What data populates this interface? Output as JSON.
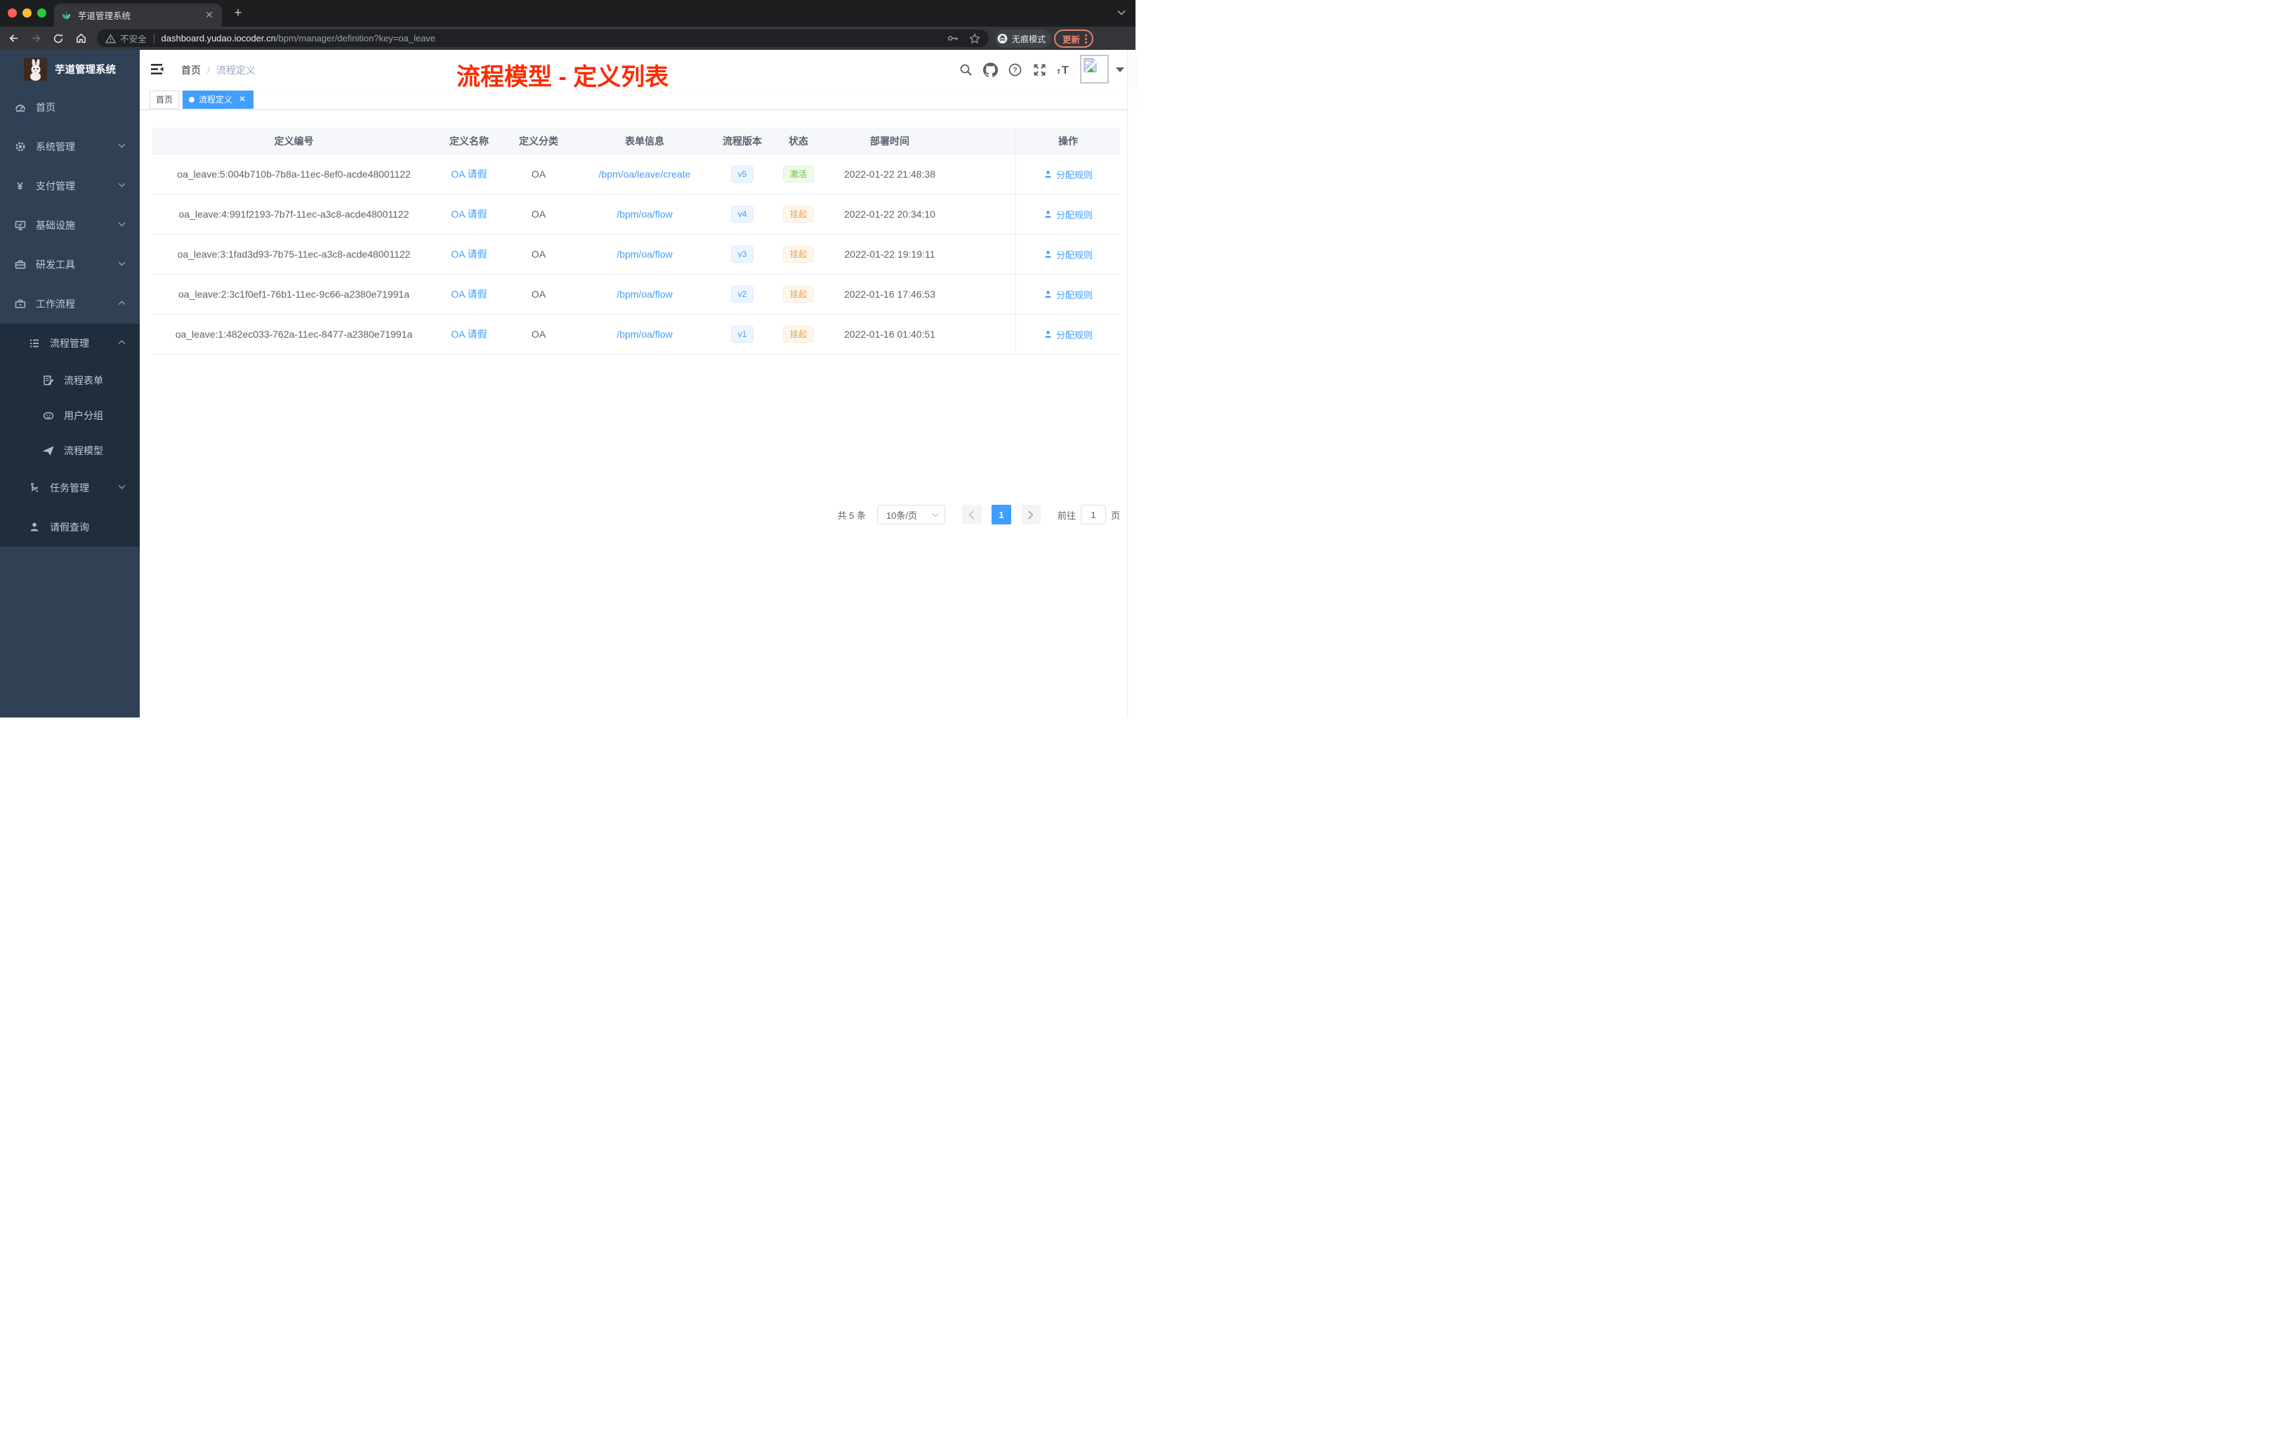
{
  "browser": {
    "tab_title": "芋道管理系统",
    "security_label": "不安全",
    "url_host": "dashboard.yudao.iocoder.cn",
    "url_path": "/bpm/manager/definition?key=oa_leave",
    "incognito_label": "无痕模式",
    "update_label": "更新"
  },
  "sidebar": {
    "app_title": "芋道管理系统",
    "items": [
      {
        "label": "首页"
      },
      {
        "label": "系统管理"
      },
      {
        "label": "支付管理"
      },
      {
        "label": "基础设施"
      },
      {
        "label": "研发工具"
      },
      {
        "label": "工作流程"
      },
      {
        "label": "流程管理"
      },
      {
        "label": "流程表单"
      },
      {
        "label": "用户分组"
      },
      {
        "label": "流程模型"
      },
      {
        "label": "任务管理"
      },
      {
        "label": "请假查询"
      }
    ]
  },
  "header": {
    "breadcrumb_home": "首页",
    "breadcrumb_separator": "/",
    "breadcrumb_current": "流程定义",
    "annotation": "流程模型 - 定义列表",
    "annotation_color": "#fd2b01"
  },
  "tags": [
    {
      "label": "首页"
    },
    {
      "label": "流程定义"
    }
  ],
  "table": {
    "columns": {
      "id": "定义编号",
      "name": "定义名称",
      "category": "定义分类",
      "form": "表单信息",
      "version": "流程版本",
      "status": "状态",
      "time": "部署时间",
      "action": "操作"
    },
    "action_label": "分配规则",
    "rows": [
      {
        "id": "oa_leave:5:004b710b-7b8a-11ec-8ef0-acde48001122",
        "name": "OA 请假",
        "category": "OA",
        "form": "/bpm/oa/leave/create",
        "version": "v5",
        "status": "激活",
        "time": "2022-01-22 21:48:38"
      },
      {
        "id": "oa_leave:4:991f2193-7b7f-11ec-a3c8-acde48001122",
        "name": "OA 请假",
        "category": "OA",
        "form": "/bpm/oa/flow",
        "version": "v4",
        "status": "挂起",
        "time": "2022-01-22 20:34:10"
      },
      {
        "id": "oa_leave:3:1fad3d93-7b75-11ec-a3c8-acde48001122",
        "name": "OA 请假",
        "category": "OA",
        "form": "/bpm/oa/flow",
        "version": "v3",
        "status": "挂起",
        "time": "2022-01-22 19:19:11"
      },
      {
        "id": "oa_leave:2:3c1f0ef1-76b1-11ec-9c66-a2380e71991a",
        "name": "OA 请假",
        "category": "OA",
        "form": "/bpm/oa/flow",
        "version": "v2",
        "status": "挂起",
        "time": "2022-01-16 17:46:53"
      },
      {
        "id": "oa_leave:1:482ec033-762a-11ec-8477-a2380e71991a",
        "name": "OA 请假",
        "category": "OA",
        "form": "/bpm/oa/flow",
        "version": "v1",
        "status": "挂起",
        "time": "2022-01-16 01:40:51"
      }
    ]
  },
  "pagination": {
    "total_label": "共 5 条",
    "page_size_label": "10条/页",
    "current_page": "1",
    "goto_label": "前往",
    "goto_value": "1",
    "page_unit_label": "页"
  },
  "colors": {
    "accent": "#409eff",
    "success": "#67c23a",
    "warning": "#e6a23c",
    "sidebar_bg": "#304156",
    "sidebar_submenu_bg": "#1f2d3d",
    "annotation_red": "#fd2b01"
  }
}
